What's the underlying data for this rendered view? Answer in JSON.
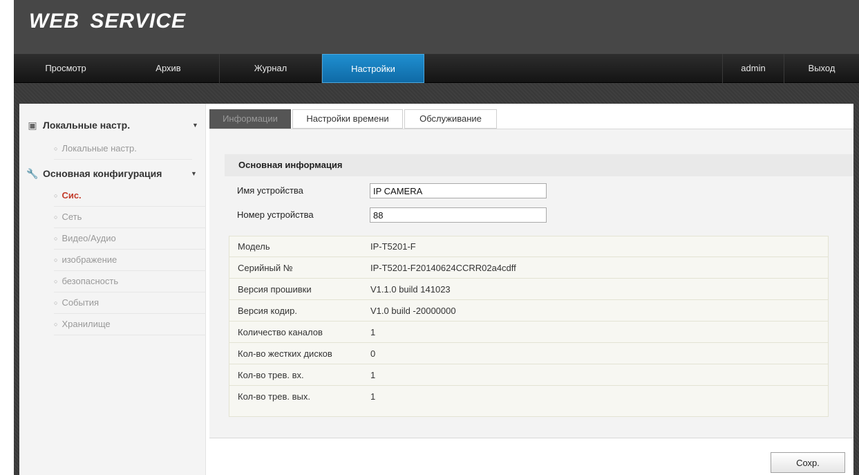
{
  "app": {
    "logo": "WEB SERVICE"
  },
  "nav": {
    "view": "Просмотр",
    "archive": "Архив",
    "journal": "Журнал",
    "settings": "Настройки",
    "user": "admin",
    "logout": "Выход"
  },
  "sidebar": {
    "local_group": "Локальные настр.",
    "local_item": "Локальные настр.",
    "basic_group": "Основная конфигурация",
    "items": [
      "Сис.",
      "Сеть",
      "Видео/Аудио",
      "изображение",
      "безопасность",
      "События",
      "Хранилище"
    ]
  },
  "tabs": {
    "info": "Информации",
    "time": "Настройки времени",
    "maintenance": "Обслуживание"
  },
  "panel": {
    "section_title": "Основная информация",
    "device_name_label": "Имя устройства",
    "device_name_value": "IP CAMERA",
    "device_number_label": "Номер устройства",
    "device_number_value": "88",
    "rows": [
      {
        "key": "Модель",
        "value": "IP-T5201-F"
      },
      {
        "key": "Серийный №",
        "value": "IP-T5201-F20140624CCRR02a4cdff"
      },
      {
        "key": "Версия прошивки",
        "value": "V1.1.0 build 141023"
      },
      {
        "key": "Версия кодир.",
        "value": "V1.0 build -20000000"
      },
      {
        "key": "Количество каналов",
        "value": "1"
      },
      {
        "key": "Кол-во жестких дисков",
        "value": "0"
      },
      {
        "key": "Кол-во трев. вх.",
        "value": "1"
      },
      {
        "key": "Кол-во трев. вых.",
        "value": "1"
      }
    ],
    "save": "Сохр."
  },
  "colors": {
    "accent": "#1a82c4",
    "active_item": "#c33b2a"
  }
}
